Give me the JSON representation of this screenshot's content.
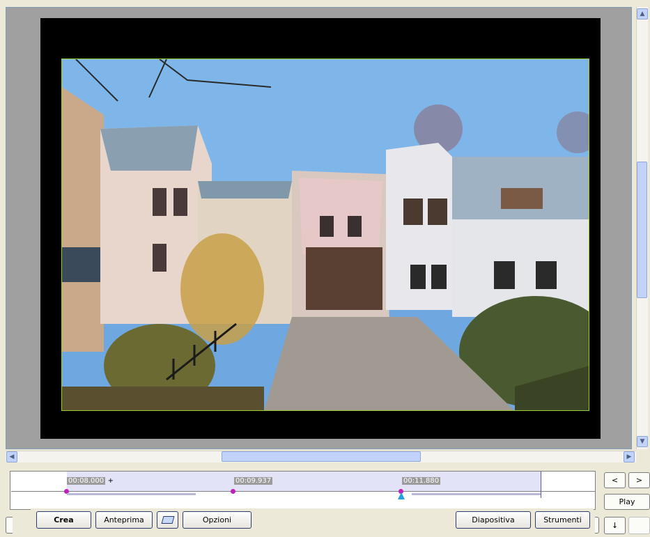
{
  "timeline": {
    "markers": [
      {
        "time": "00:08.000",
        "suffix": "+"
      },
      {
        "time": "00:09.937",
        "suffix": ""
      },
      {
        "time": "00:11.880",
        "suffix": ""
      }
    ]
  },
  "controls": {
    "prev_label": "<",
    "next_label": ">",
    "play_label": "Play",
    "down_label": "↓"
  },
  "toolbar": {
    "crea_label": "Crea",
    "anteprima_label": "Anteprima",
    "opzioni_label": "Opzioni",
    "diapositiva_label": "Diapositiva",
    "strumenti_label": "Strumenti"
  },
  "icons": {
    "scroll_up": "chevron-up-icon",
    "scroll_down": "chevron-down-icon",
    "scroll_left": "chevron-left-icon",
    "scroll_right": "chevron-right-icon",
    "frame": "frame-icon"
  },
  "colors": {
    "accent": "#2c3c73",
    "keyframe": "#c020c0",
    "cursor": "#1fa0e0",
    "photo_border": "#9acd32"
  }
}
